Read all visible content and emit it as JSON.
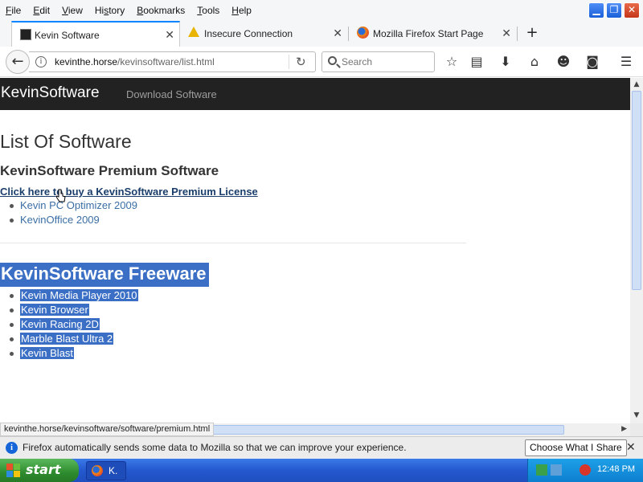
{
  "menu": [
    "File",
    "Edit",
    "View",
    "History",
    "Bookmarks",
    "Tools",
    "Help"
  ],
  "menu_underline": [
    "F",
    "E",
    "V",
    "s",
    "B",
    "T",
    "H"
  ],
  "window_controls": {
    "minimize": "▁",
    "maximize": "❐",
    "close": "✕"
  },
  "tabs": [
    {
      "label": "Kevin Software",
      "icon": "kevinsoftware-favicon",
      "active": true
    },
    {
      "label": "Insecure Connection",
      "icon": "warning-icon",
      "active": false
    },
    {
      "label": "Mozilla Firefox Start Page",
      "icon": "firefox-icon",
      "active": false
    }
  ],
  "new_tab": "+",
  "url": {
    "host": "kevinthe.horse",
    "path": "/kevinsoftware/list.html"
  },
  "search": {
    "placeholder": "Search"
  },
  "toolbar_icons": [
    "bookmark-star-icon",
    "reader-view-icon",
    "downloads-icon",
    "home-icon",
    "chat-icon",
    "pocket-icon",
    "menu-icon"
  ],
  "site": {
    "brand": "KevinSoftware",
    "nav_link": "Download Software",
    "page_title": "List Of Software",
    "premium_heading": "KevinSoftware Premium Software",
    "buy_link": "Click here to buy a KevinSoftware Premium License",
    "premium_items": [
      "Kevin PC Optimizer 2009",
      "KevinOffice 2009"
    ],
    "freeware_heading": "KevinSoftware Freeware",
    "freeware_items": [
      "Kevin Media Player 2010",
      "Kevin Browser",
      "Kevin Racing 2D",
      "Marble Blast Ultra 2",
      "Kevin Blast"
    ]
  },
  "status_url": "kevinthe.horse/kevinsoftware/software/premium.html",
  "notification": {
    "text": "Firefox automatically sends some data to Mozilla so that we can improve your experience.",
    "button": "Choose What I Share",
    "close": "✕"
  },
  "taskbar": {
    "start": "start",
    "task_label": "K.",
    "time": "12:48 PM"
  },
  "colors": {
    "accent": "#0a84ff",
    "site_nav_bg": "#222222",
    "selection": "#3b6fc5",
    "link": "#3a6ea5"
  }
}
